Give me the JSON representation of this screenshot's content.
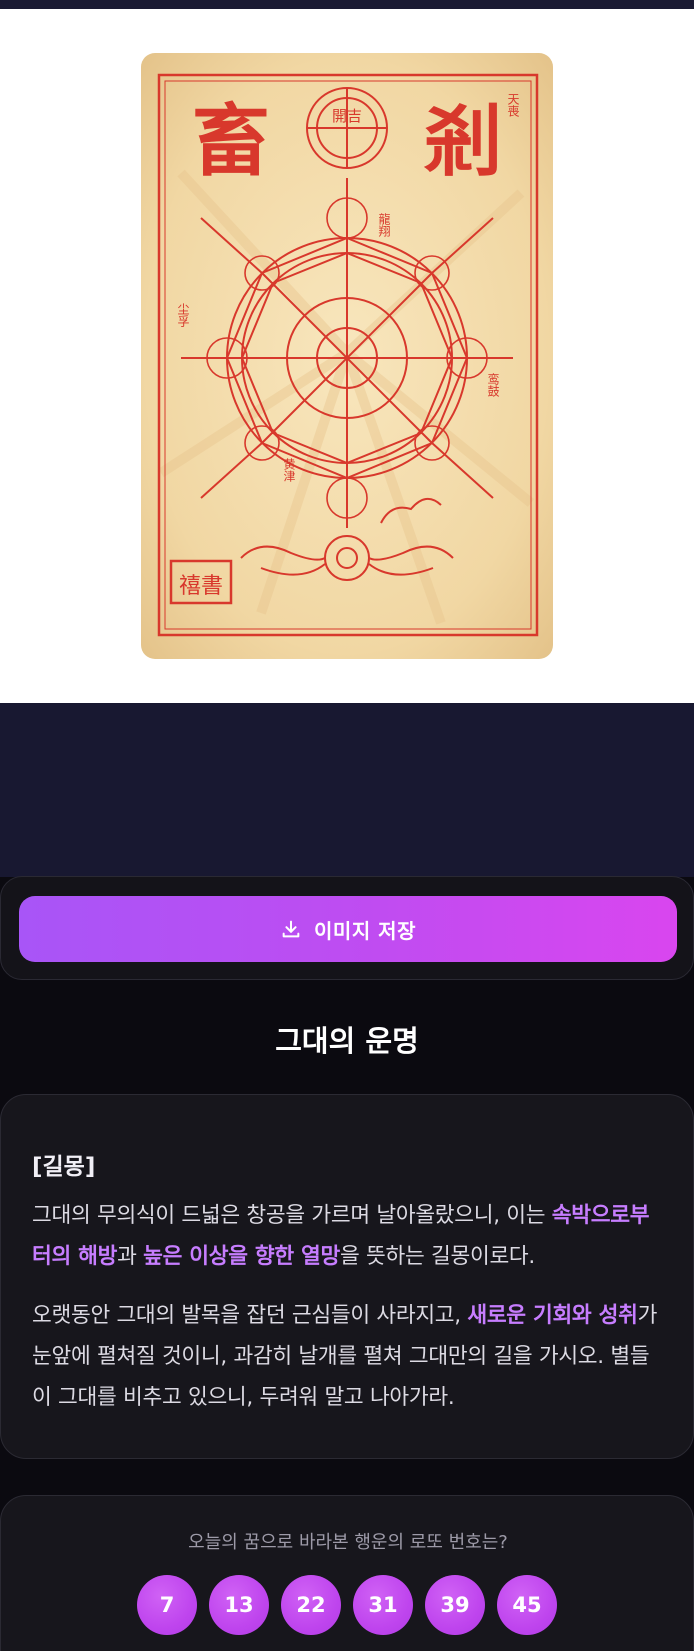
{
  "image": {
    "left_char": "畜",
    "right_char": "剎",
    "top_right_text": "天喪",
    "upper_mid_text": "龍翔",
    "left_mid_text": "尘孚",
    "right_mid_text": "鸾鼓",
    "lower_mid_text": "黄津",
    "seal_text": "禧書",
    "top_circle_text": "開吉"
  },
  "save_button": {
    "label": "이미지 저장",
    "icon": "download-icon"
  },
  "destiny_title": "그대의 운명",
  "dream": {
    "tag": "[길몽]",
    "p1": {
      "t1": "그대의 무의식이 드넓은 창공을 가르며 날아올랐으니, 이는 ",
      "h1": "속박으로부터의 해방",
      "t2": "과 ",
      "h2": "높은 이상을 향한 열망",
      "t3": "을 뜻하는 길몽이로다."
    },
    "p2": {
      "t1": "오랫동안 그대의 발목을 잡던 근심들이 사라지고, ",
      "h1": "새로운 기회와 성취",
      "t2": "가 눈앞에 펼쳐질 것이니, 과감히 날개를 펼쳐 그대만의 길을 가시오. 별들이 그대를 비추고 있으니, 두려워 말고 나아가라."
    }
  },
  "lotto": {
    "question": "오늘의 꿈으로 바라본 행운의 로또 번호는?",
    "numbers": [
      "7",
      "13",
      "22",
      "31",
      "39",
      "45"
    ]
  },
  "colors": {
    "accent_start": "#a855f7",
    "accent_end": "#d946ef",
    "highlight": "#c77dff",
    "talisman_red": "#d8382c",
    "paper": "#f3dcaa"
  }
}
